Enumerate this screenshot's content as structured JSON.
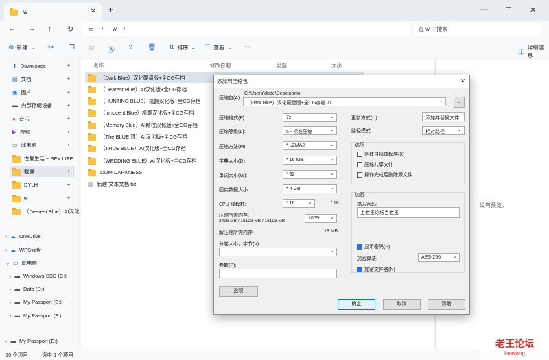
{
  "window": {
    "tab_title": "w",
    "new_tab": "+",
    "minimize": "—",
    "maximize": "☐",
    "close": "✕"
  },
  "nav": {
    "path_sep": "›",
    "folder": "w",
    "search_placeholder": "在 w 中搜索"
  },
  "toolbar": {
    "new": "新建",
    "sort": "排序",
    "view": "查看",
    "more": "···",
    "details": "详细信息"
  },
  "sidebar": [
    {
      "label": "Downloads",
      "pinned": true
    },
    {
      "label": "文档",
      "pinned": true
    },
    {
      "label": "图片",
      "pinned": true
    },
    {
      "label": "内部存储设备",
      "pinned": true
    },
    {
      "label": "音乐",
      "pinned": true
    },
    {
      "label": "视频",
      "pinned": true
    },
    {
      "label": "此电脑",
      "pinned": true
    },
    {
      "label": "性爱生活 ~ SEX LIFE",
      "pinned": true
    },
    {
      "label": "截屏",
      "pinned": true
    },
    {
      "label": "DYLH",
      "pinned": true
    },
    {
      "label": "w",
      "pinned": true
    },
    {
      "label": "（Dearest Blue）AI汉化",
      "pinned": false
    }
  ],
  "sidebar_tree": [
    {
      "label": "OneDrive"
    },
    {
      "label": "WPS云盘"
    },
    {
      "label": "此电脑"
    },
    {
      "label": "Windows-SSD (C:)"
    },
    {
      "label": "Data (D:)"
    },
    {
      "label": "My Passport (E:)"
    },
    {
      "label": "My Passport (F:)"
    },
    {
      "label": "My Passport (E:)"
    }
  ],
  "columns": {
    "name": "名称",
    "date": "修改日期",
    "type": "类型",
    "size": "大小"
  },
  "files": [
    {
      "name": "（Dark Blue）汉化硬盘版+全CG存档",
      "date": "2"
    },
    {
      "name": "（Dearest Blue）AI汉化版+全CG存档",
      "date": "2"
    },
    {
      "name": "（HUNTING BLUE）机翻汉化版+全CG存档",
      "date": "2"
    },
    {
      "name": "（Innocent Blue）机翻汉化版+全CG存档",
      "date": "2"
    },
    {
      "name": "（Memory Blue）AI精校汉化版+全CG存档",
      "date": "2"
    },
    {
      "name": "（The BLUE 顶）AI汉化版+全CG存档",
      "date": "2"
    },
    {
      "name": "（TRUE BLUE）AI汉化版+全CG存档",
      "date": "2"
    },
    {
      "name": "（WEDDING BLUE）AI汉化版+全CG存档",
      "date": "2"
    },
    {
      "name": "LiLiM DARKNESS",
      "date": "2"
    },
    {
      "name": "新建 文本文档.txt",
      "date": "2"
    }
  ],
  "preview_text": "没有预览。",
  "status": {
    "count": "10 个项目",
    "selected": "选中 1 个项目"
  },
  "dialog": {
    "title": "添加到压缩包",
    "archive_label": "压缩包(A):",
    "archive_dir": "C:\\Users\\dude\\Desktop\\w\\",
    "archive_name": "（Dark Blue）汉化硬盘版+全CG存档.7z",
    "browse": "...",
    "format_label": "压缩格式(F):",
    "format": "7z",
    "level_label": "压缩等级(L):",
    "level": "5 - 标准压缩",
    "method_label": "压缩方法(M):",
    "method": "* LZMA2",
    "dict_label": "字典大小(D):",
    "dict": "* 16 MB",
    "word_label": "单词大小(W):",
    "word": "* 32",
    "solid_label": "固实数据大小:",
    "solid": "* 4 GB",
    "cpu_label": "CPU 线程数:",
    "cpu": "* 16",
    "cpu_total": "/ 16",
    "mem_label": "压缩所需内存:",
    "mem_detail": "2496 MB / 16193 MB / 16193 MB",
    "mem_pct": "100%",
    "decomp_label": "解压缩所需内存:",
    "decomp": "18 MB",
    "split_label": "分卷大小，字节(V):",
    "params_label": "参数(P):",
    "options_btn": "选项",
    "update_label": "更新方式(U):",
    "update": "添加并替换文件",
    "path_label": "路径模式",
    "path": "相对路径",
    "opts_title": "选项",
    "opt1": "创建自释放程序(X)",
    "opt2": "压缩共享文件",
    "opt3": "操作完成后删除源文件",
    "enc_title": "加密",
    "pwd_label": "输入密码:",
    "pwd": "上老王论坛当老王",
    "show_pwd": "显示密码(S)",
    "enc_method_label": "加密算法:",
    "enc_method": "AES-256",
    "enc_names": "加密文件名(N)",
    "ok": "确定",
    "cancel": "取消",
    "help": "帮助"
  },
  "watermark": {
    "line1": "老王论坛",
    "line2": "laowang"
  }
}
